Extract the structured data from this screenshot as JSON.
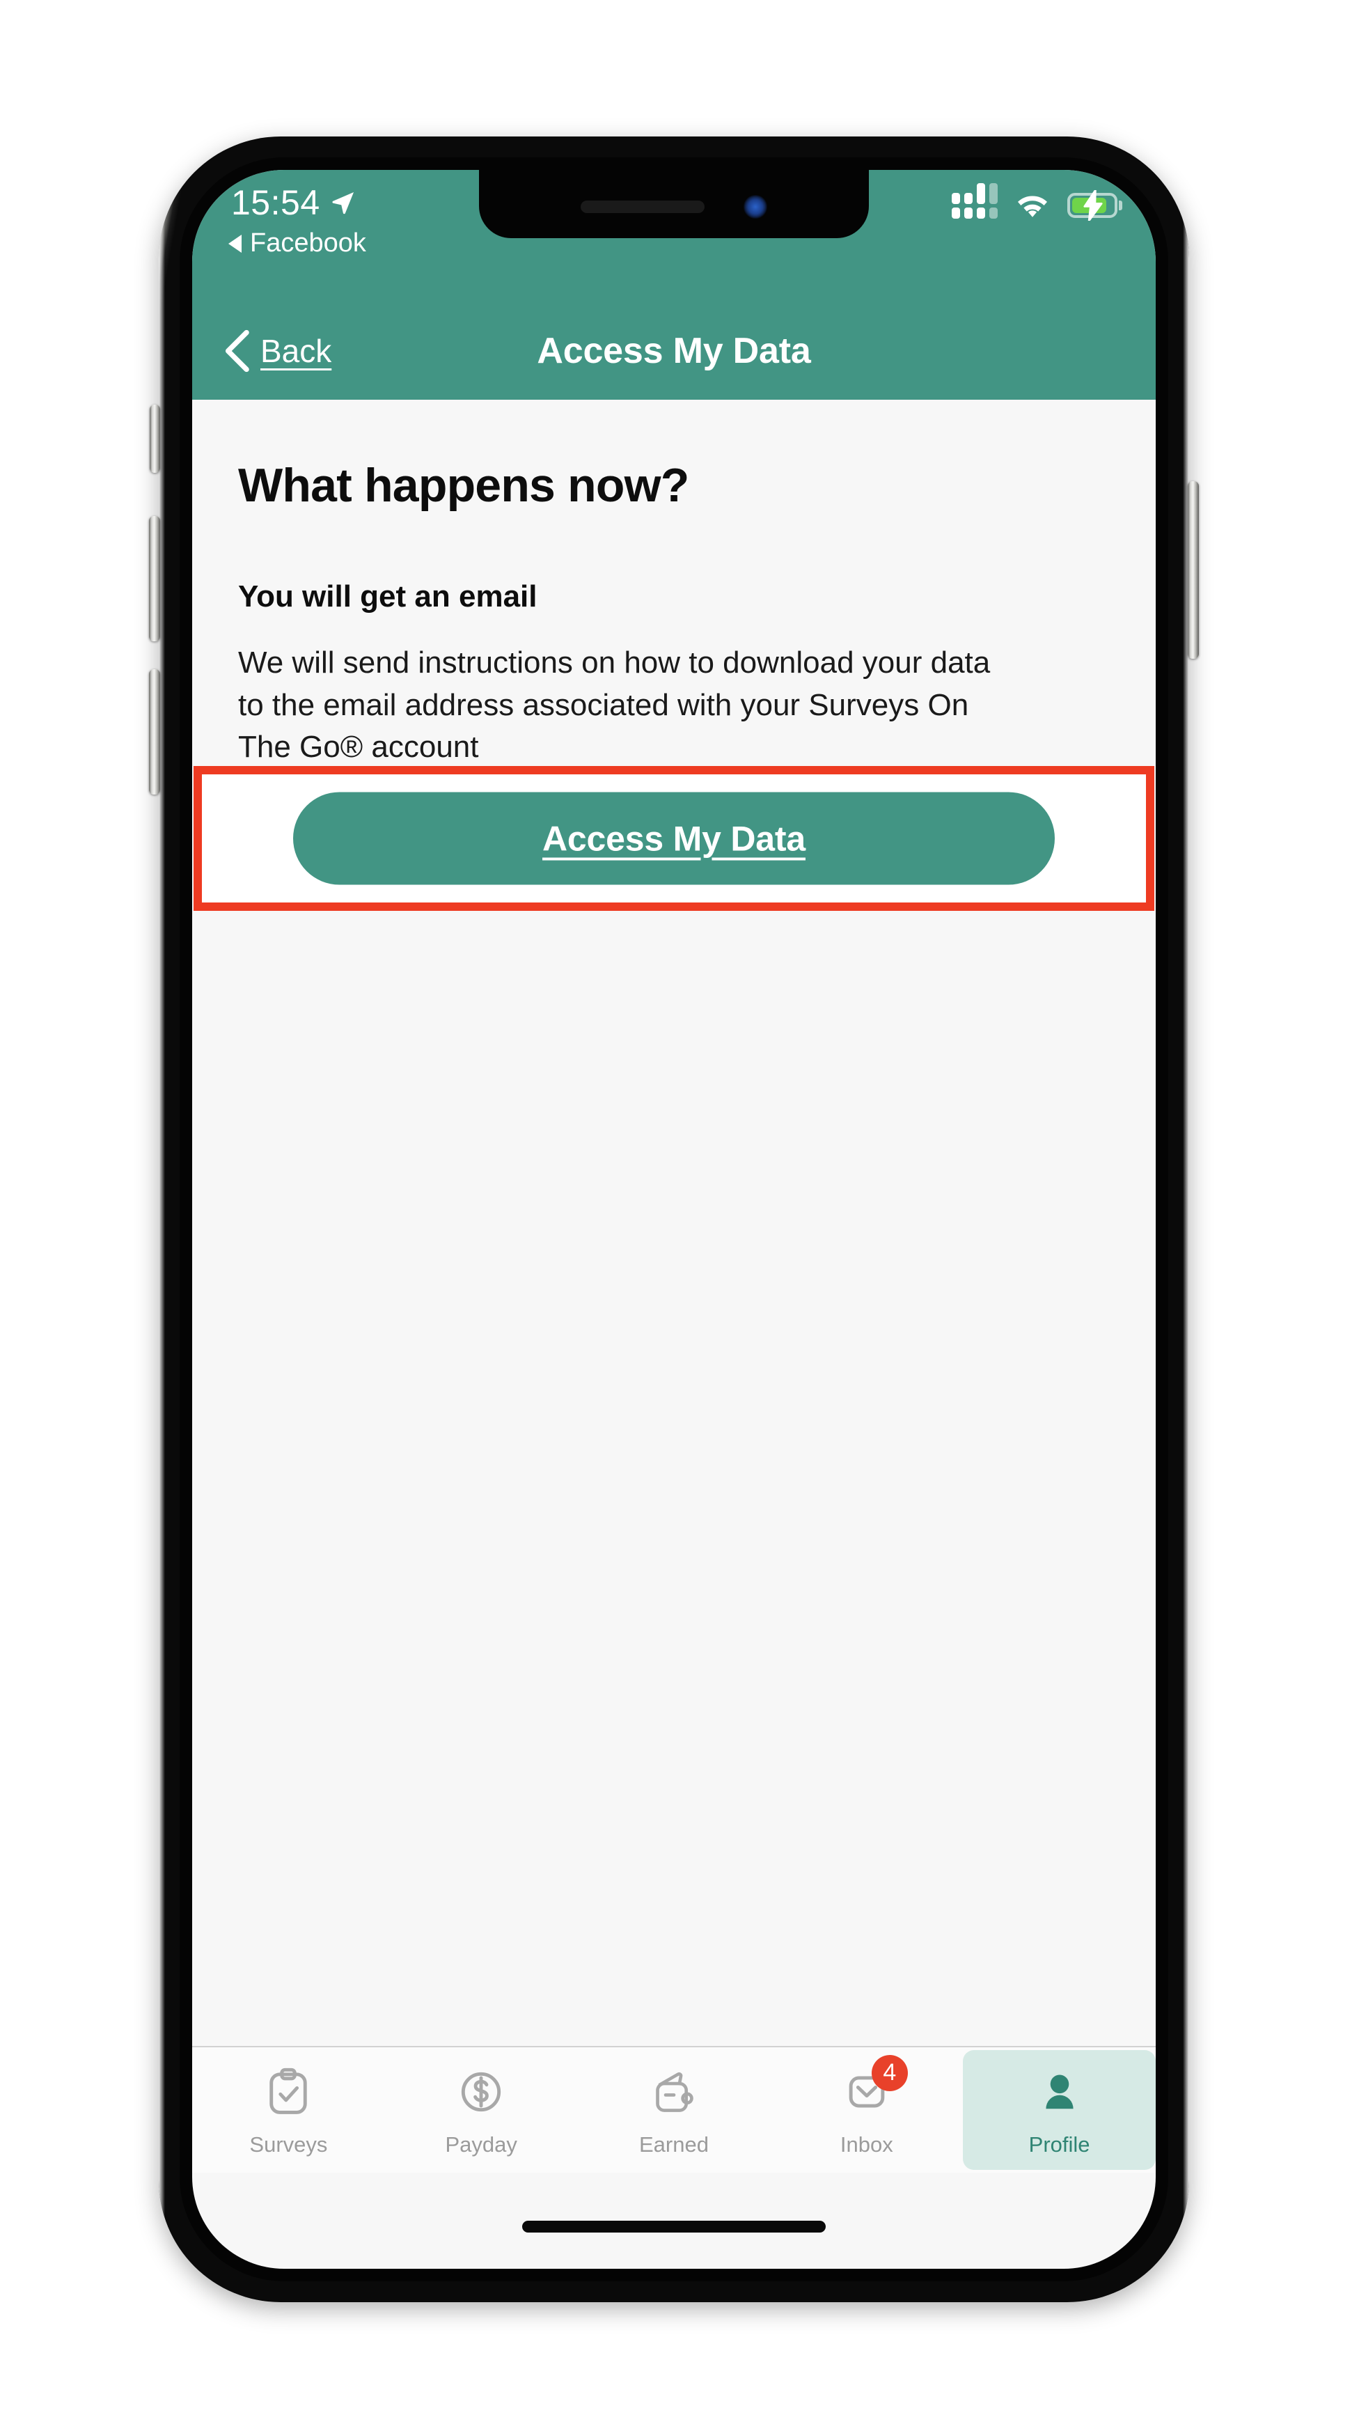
{
  "status_bar": {
    "time": "15:54",
    "location_icon": "location-arrow-icon",
    "back_to_app_label": "Facebook",
    "cellular_icon": "cellular-signal-icon",
    "wifi_icon": "wifi-icon",
    "battery_icon": "battery-charging-icon"
  },
  "nav": {
    "back_label": "Back",
    "back_icon": "chevron-left-icon",
    "title": "Access My Data"
  },
  "content": {
    "heading": "What happens now?",
    "subheading": "You will get an email",
    "body": "We will send instructions on how to download your data to the email address associated with your Surveys On The Go® account"
  },
  "primary_action": {
    "label": "Access My Data"
  },
  "tabs": [
    {
      "label": "Surveys",
      "icon": "clipboard-check-icon",
      "active": false,
      "badge": null
    },
    {
      "label": "Payday",
      "icon": "dollar-coin-icon",
      "active": false,
      "badge": null
    },
    {
      "label": "Earned",
      "icon": "wallet-icon",
      "active": false,
      "badge": null
    },
    {
      "label": "Inbox",
      "icon": "envelope-icon",
      "active": false,
      "badge": "4"
    },
    {
      "label": "Profile",
      "icon": "person-icon",
      "active": true,
      "badge": null
    }
  ],
  "colors": {
    "brand_teal": "#429584",
    "highlight_red": "#ee3b22",
    "badge_red": "#e8412a",
    "active_tab_bg": "#d6eae5",
    "active_tab_fg": "#2f8473",
    "screen_bg": "#f7f7f7"
  }
}
